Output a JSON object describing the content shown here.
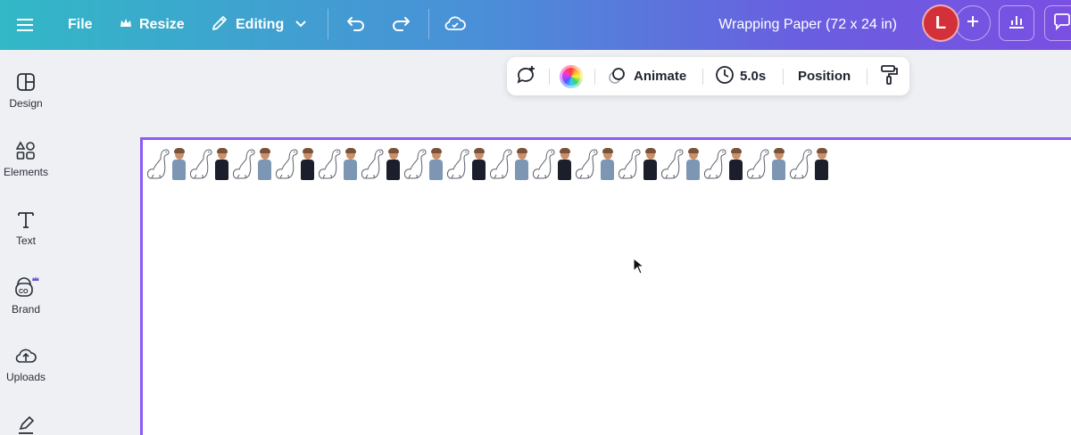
{
  "topbar": {
    "file_label": "File",
    "resize_label": "Resize",
    "editing_label": "Editing",
    "doc_title": "Wrapping Paper (72 x 24 in)",
    "avatar_initial": "L"
  },
  "sidebar": {
    "items": [
      {
        "label": "Design",
        "icon": "design-icon"
      },
      {
        "label": "Elements",
        "icon": "elements-icon"
      },
      {
        "label": "Text",
        "icon": "text-icon"
      },
      {
        "label": "Brand",
        "icon": "brand-icon"
      },
      {
        "label": "Uploads",
        "icon": "uploads-icon"
      },
      {
        "label": "",
        "icon": "draw-icon"
      }
    ]
  },
  "float_toolbar": {
    "animate_label": "Animate",
    "duration_label": "5.0s",
    "position_label": "Position"
  },
  "colors": {
    "canvas_border": "#8b5cf6",
    "avatar_bg": "#d3303a",
    "topbar_start": "#32b8c6",
    "topbar_end": "#7a4fe2"
  },
  "canvas": {
    "pattern": [
      "dino",
      "blue",
      "dino",
      "dark",
      "dino",
      "blue",
      "dino",
      "dark",
      "dino",
      "blue",
      "dino",
      "dark",
      "dino",
      "blue",
      "dino",
      "dark",
      "dino",
      "blue",
      "dino",
      "dark",
      "dino",
      "blue",
      "dino",
      "dark",
      "dino",
      "blue",
      "dino",
      "dark",
      "dino",
      "blue",
      "dino",
      "dark"
    ]
  }
}
